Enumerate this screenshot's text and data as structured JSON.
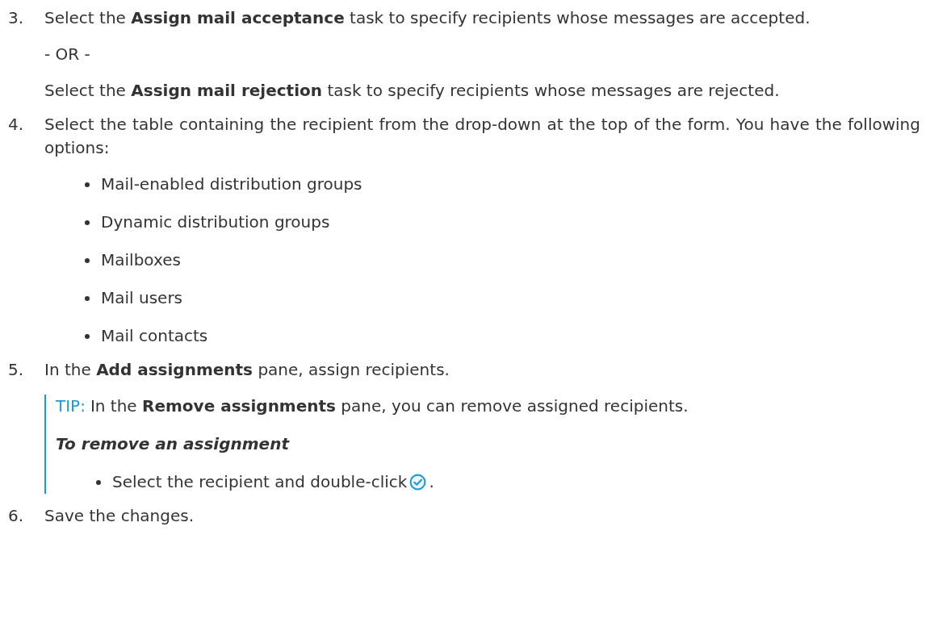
{
  "steps": [
    {
      "number": "3.",
      "paragraphs": [
        "Select the **Assign mail acceptance** task to specify recipients whose messages are accepted.",
        "- OR -",
        "Select the **Assign mail rejection** task to specify recipients whose messages are rejected."
      ]
    },
    {
      "number": "4.",
      "paragraphs": [
        "Select the table containing the recipient from the drop-down at the top of the form. You have the following options:"
      ],
      "bullets": [
        "Mail-enabled distribution groups",
        "Dynamic distribution groups",
        "Mailboxes",
        "Mail users",
        "Mail contacts"
      ]
    },
    {
      "number": "5.",
      "paragraphs": [
        "In the **Add assignments** pane, assign recipients."
      ],
      "tip": {
        "label": "TIP:",
        "text": "In the **Remove assignments** pane, you can remove assigned recipients.",
        "heading": "To remove an assignment",
        "bullets": [
          {
            "text_before": "Select the recipient and double-click",
            "text_after": "."
          }
        ]
      }
    },
    {
      "number": "6.",
      "paragraphs": [
        "Save the changes."
      ]
    }
  ]
}
